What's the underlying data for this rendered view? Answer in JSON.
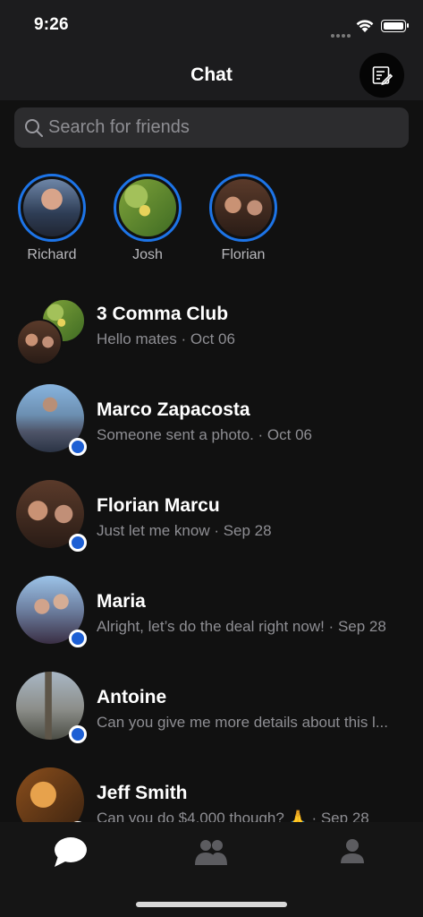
{
  "status_bar": {
    "time": "9:26"
  },
  "nav": {
    "title": "Chat",
    "compose_icon": "compose-icon"
  },
  "search": {
    "placeholder": "Search for friends",
    "icon": "search-icon"
  },
  "stories": [
    {
      "name": "Richard"
    },
    {
      "name": "Josh"
    },
    {
      "name": "Florian"
    }
  ],
  "conversations": [
    {
      "name": "3 Comma Club",
      "snippet": "Hello mates · Oct 06",
      "unread": false
    },
    {
      "name": "Marco Zapacosta",
      "snippet": "Someone sent a photo. · Oct 06",
      "unread": true
    },
    {
      "name": "Florian Marcu",
      "snippet": "Just let me know · Sep 28",
      "unread": true
    },
    {
      "name": "Maria",
      "snippet": "Alright, let’s do the deal right now! · Sep 28",
      "unread": true
    },
    {
      "name": "Antoine",
      "snippet": "Can you give me more details about this l...",
      "unread": true
    },
    {
      "name": "Jeff Smith",
      "snippet": "Can you do $4,000 though? 🙏 · Sep 28",
      "unread": true
    }
  ],
  "tabs": [
    {
      "icon": "chat-bubble-icon",
      "active": true
    },
    {
      "icon": "friends-icon",
      "active": false
    },
    {
      "icon": "profile-icon",
      "active": false
    }
  ],
  "colors": {
    "background": "#111111",
    "accent": "#1d74e7",
    "unread_dot": "#1d5fd4",
    "secondary_text": "#8e8e93"
  }
}
